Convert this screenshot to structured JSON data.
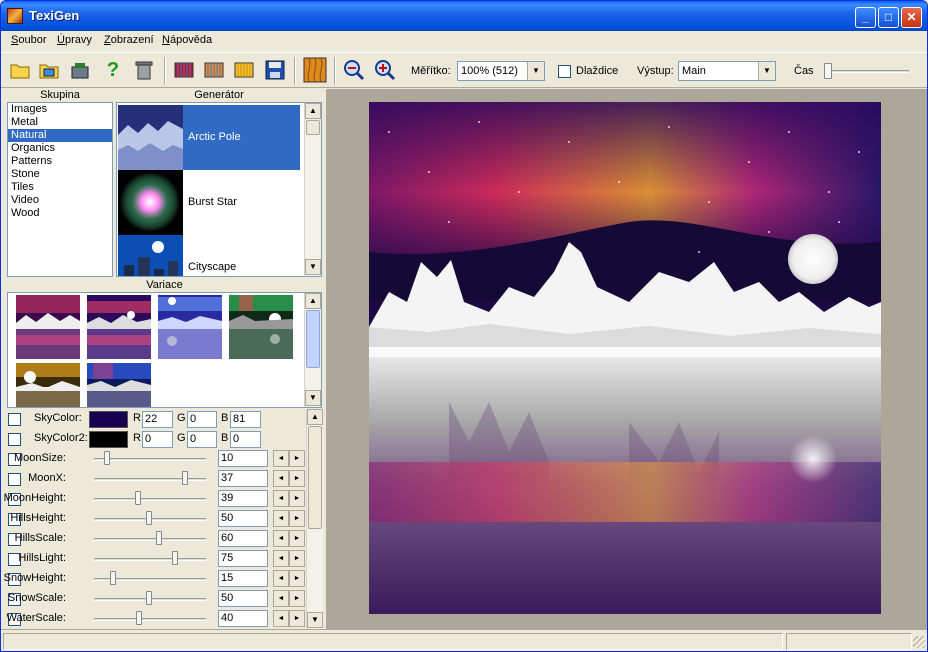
{
  "app": {
    "title": "TexiGen"
  },
  "colors": {
    "title_blue": "#0a5ff0",
    "selection": "#316ac5",
    "sky_color": "#16004f",
    "sky_color2": "#000000"
  },
  "window_buttons": {
    "minimize": "_",
    "maximize": "□",
    "close": "✕"
  },
  "menu": [
    {
      "first": "S",
      "rest": "oubor"
    },
    {
      "first": "Ú",
      "rest": "pravy"
    },
    {
      "first": "Z",
      "rest": "obrazení"
    },
    {
      "first": "N",
      "rest": "ápověda"
    }
  ],
  "toolbar": {
    "icons": [
      "open-folder-icon",
      "open-image-icon",
      "save-folder-icon",
      "help-icon",
      "trash-icon",
      "texture-red-icon",
      "texture-orange-icon",
      "texture-yellow-icon",
      "save-disk-icon",
      "wood-texture-icon",
      "zoom-out-icon",
      "zoom-in-icon"
    ],
    "help_glyph": "?",
    "scale_label": "Měřítko:",
    "scale_value": "100% (512)",
    "tile_label": "Dlaždice",
    "tile_checked": false,
    "output_label": "Výstup:",
    "output_value": "Main",
    "time_label": "Čas",
    "time_value": 0
  },
  "group": {
    "header": "Skupina",
    "items": [
      "Images",
      "Metal",
      "Natural",
      "Organics",
      "Patterns",
      "Stone",
      "Tiles",
      "Video",
      "Wood"
    ],
    "selected": "Natural"
  },
  "generator": {
    "header": "Generátor",
    "items": [
      "Arctic Pole",
      "Burst Star",
      "Cityscape"
    ],
    "selected": "Arctic Pole"
  },
  "variations": {
    "header": "Variace"
  },
  "params": {
    "sky_color": {
      "label": "SkyColor:",
      "r_label": "R",
      "g_label": "G",
      "b_label": "B",
      "r": "22",
      "g": "0",
      "b": "81"
    },
    "sky_color2": {
      "label": "SkyColor2:",
      "r_label": "R",
      "g_label": "G",
      "b_label": "B",
      "r": "0",
      "g": "0",
      "b": "0"
    },
    "sliders": [
      {
        "label": "MoonSize:",
        "value": "10"
      },
      {
        "label": "MoonX:",
        "value": "37"
      },
      {
        "label": "MoonHeight:",
        "value": "39"
      },
      {
        "label": "HillsHeight:",
        "value": "50"
      },
      {
        "label": "HillsScale:",
        "value": "60"
      },
      {
        "label": "HillsLight:",
        "value": "75"
      },
      {
        "label": "SnowHeight:",
        "value": "15"
      },
      {
        "label": "SnowScale:",
        "value": "50"
      },
      {
        "label": "WaterScale:",
        "value": "40"
      }
    ],
    "spin_left": "◄",
    "spin_right": "►"
  },
  "scroll_glyphs": {
    "up": "▲",
    "down": "▼"
  }
}
